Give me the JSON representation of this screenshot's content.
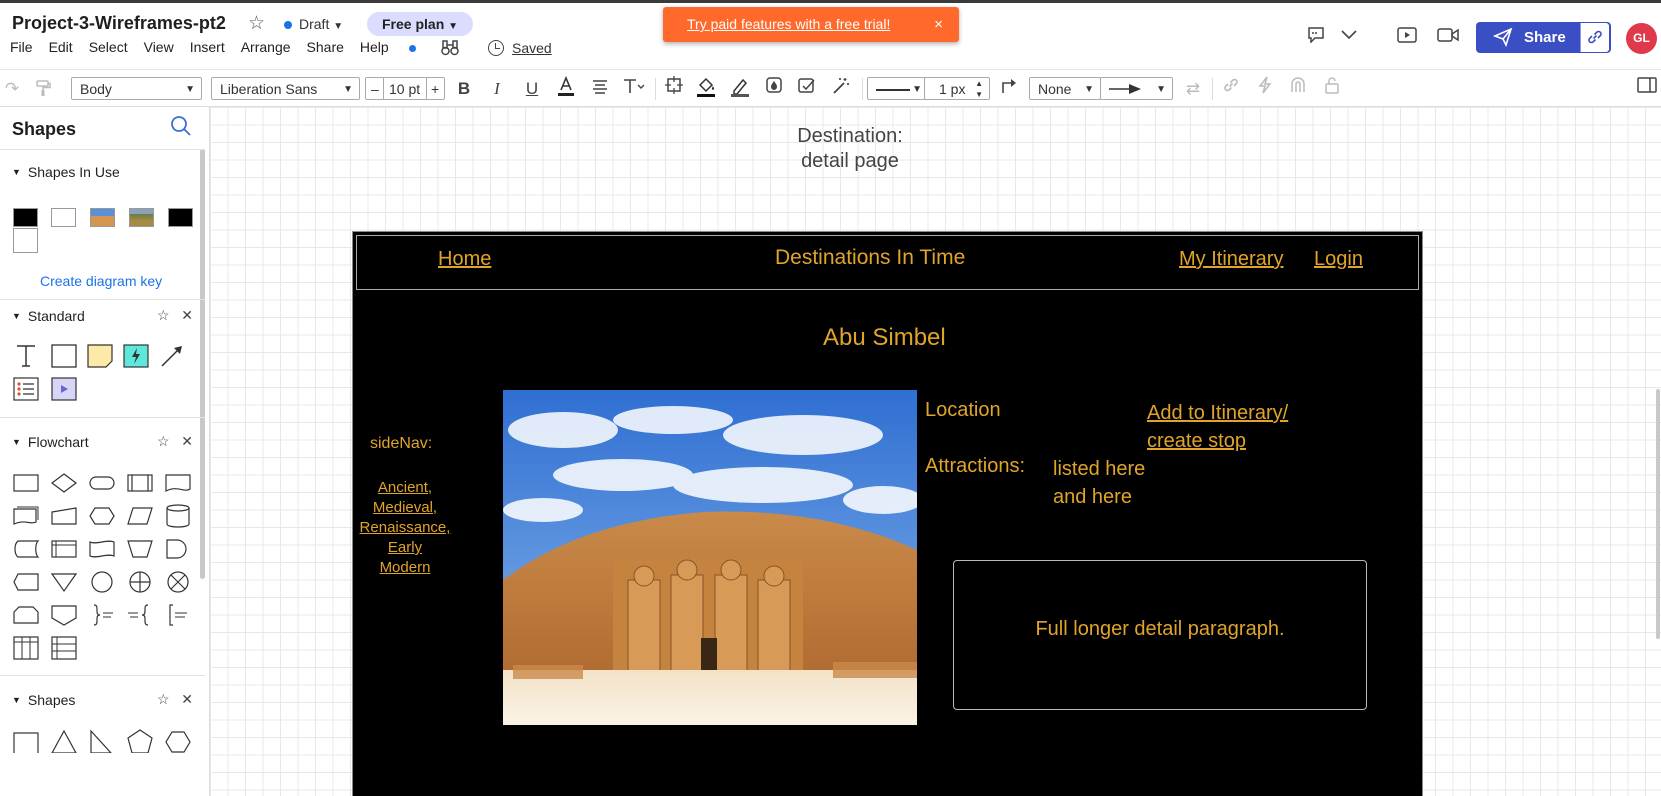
{
  "header": {
    "doc_title": "Project-3-Wireframes-pt2",
    "draft_label": "Draft",
    "plan_label": "Free plan",
    "menu": [
      "File",
      "Edit",
      "Select",
      "View",
      "Insert",
      "Arrange",
      "Share",
      "Help"
    ],
    "saved_label": "Saved",
    "banner_text": "Try paid features with a free trial!",
    "banner_close": "×",
    "share_label": "Share",
    "avatar_initials": "GL",
    "accent_color": "#3b4fc4",
    "banner_color": "#ff6a2c"
  },
  "toolbar": {
    "text_style": "Body",
    "font_family": "Liberation Sans",
    "font_size": "10 pt",
    "decrease": "–",
    "increase": "+",
    "bold": "B",
    "italic": "I",
    "underline": "U",
    "line_width": "1 px",
    "arrow_start": "None"
  },
  "shapes_panel": {
    "title": "Shapes",
    "sections": [
      {
        "label": "Shapes In Use"
      },
      {
        "label": "Standard"
      },
      {
        "label": "Flowchart"
      },
      {
        "label": "Shapes"
      }
    ],
    "create_key": "Create diagram key"
  },
  "canvas": {
    "page_label_line1": "Destination:",
    "page_label_line2": "detail page",
    "wireframe": {
      "nav_home": "Home",
      "nav_title": "Destinations In Time",
      "nav_itinerary": "My Itinerary",
      "nav_login": "Login",
      "heading": "Abu Simbel",
      "sidenav_label": "sideNav:",
      "sidenav_links": [
        "Ancient,",
        "Medieval,",
        "Renaissance,",
        "Early",
        "Modern"
      ],
      "location_label": "Location",
      "add_link_line1": "Add to Itinerary/",
      "add_link_line2": "create stop",
      "attractions_label": "Attractions:",
      "attractions_line1": "listed here",
      "attractions_line2": "and here",
      "detail_paragraph": "Full longer detail paragraph.",
      "text_color": "#e0a42a"
    }
  }
}
